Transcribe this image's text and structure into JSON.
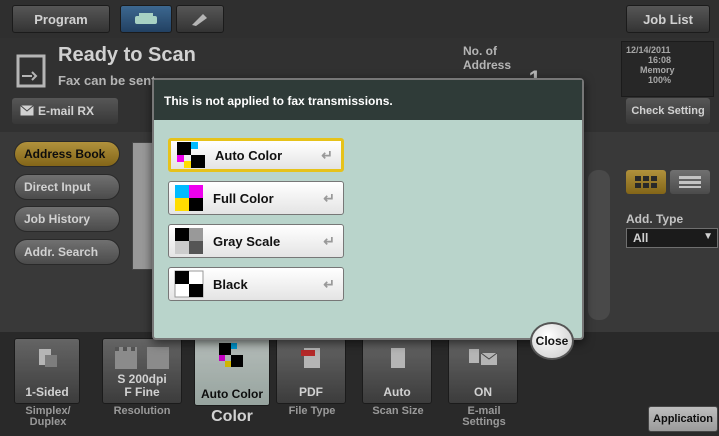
{
  "topbar": {
    "program": "Program",
    "job_list": "Job List"
  },
  "status": {
    "title": "Ready to Scan",
    "subtitle": "Fax can be sent a",
    "no_of_address_label": "No. of Address",
    "no_of_address_value": "1",
    "email_rx": "E-mail RX",
    "date": "12/14/2011",
    "time": "16:08",
    "memory_label": "Memory",
    "memory_value": "100%",
    "check_setting": "Check Setting"
  },
  "nav": [
    "Address Book",
    "Direct Input",
    "Job History",
    "Addr. Search"
  ],
  "add_type": {
    "label": "Add. Type",
    "value": "All"
  },
  "dialog": {
    "message": "This is not applied to fax transmissions.",
    "options": [
      "Auto Color",
      "Full Color",
      "Gray Scale",
      "Black"
    ],
    "selected": "Auto Color",
    "close": "Close"
  },
  "toolbar": [
    {
      "value": "1-Sided",
      "label": "Simplex/\nDuplex"
    },
    {
      "value": "S 200dpi\nF Fine",
      "label": "Resolution"
    },
    {
      "value": "Auto Color",
      "label": "Color"
    },
    {
      "value": "PDF",
      "label": "File Type"
    },
    {
      "value": "Auto",
      "label": "Scan Size"
    },
    {
      "value": "ON",
      "label": "E-mail\nSettings"
    }
  ],
  "application": "Application",
  "colors": {
    "accent": "#e6c21a",
    "dialog_bg": "#b9d4cb",
    "dialog_header": "#2f3b38"
  }
}
